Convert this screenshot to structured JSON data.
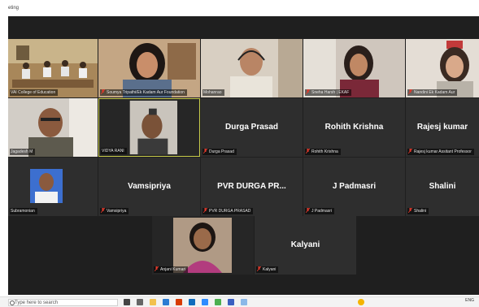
{
  "window": {
    "title": "eting"
  },
  "tiles": [
    {
      "label": "VAI College of Education"
    },
    {
      "label": "Soumya Tripathi/Ek Kadam Aur Foundation"
    },
    {
      "label": "Mohanrao"
    },
    {
      "label": "Sneha Harsh | EKAF"
    },
    {
      "label": "Nandini Ek Kadam Aur"
    },
    {
      "label": "Jagadesh M"
    },
    {
      "label": "VIDYA RANI"
    },
    {
      "name": "Durga Prasad",
      "label": "Durga Prasad"
    },
    {
      "name": "Rohith Krishna",
      "label": "Rohith Krishna"
    },
    {
      "name": "Rajesj kumar",
      "label": "Rajesj kumar Assitant Professor"
    },
    {
      "label": "Subramonian"
    },
    {
      "name": "Vamsipriya",
      "label": "Vamsipriya"
    },
    {
      "name": "PVR DURGA PR...",
      "label": "PVR DURGA PRASAD"
    },
    {
      "name": "J Padmasri",
      "label": "J Padmasri"
    },
    {
      "name": "Shalini",
      "label": "Shalini"
    },
    {
      "label": "Anjani Kumari"
    },
    {
      "name": "Kalyani",
      "label": "Kalyani"
    }
  ],
  "taskbar": {
    "search_placeholder": "Type here to search",
    "tray_text": "ENG"
  },
  "colors": {
    "stage_bg": "#1f1f1f",
    "tile_bg": "#2e2e2e",
    "active_speaker_border": "#c8cc4a",
    "muted_mic": "#e0392b"
  }
}
